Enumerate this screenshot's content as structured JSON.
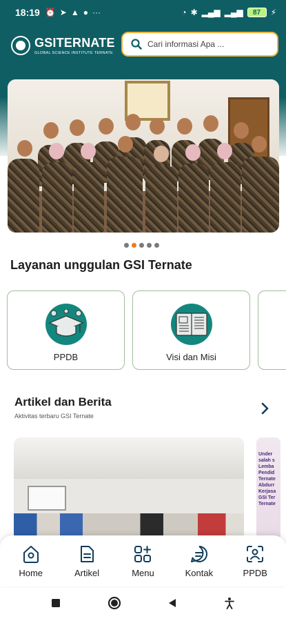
{
  "status_bar": {
    "time": "18:19",
    "battery": "87"
  },
  "header": {
    "logo_brand": "GSITERNATE",
    "logo_sub": "GLOBAL SCIENCE INSTITUTE TERNATE",
    "search_placeholder": "Cari informasi Apa ..."
  },
  "carousel": {
    "dots": 5,
    "active_index": 1
  },
  "services": {
    "title": "Layanan unggulan GSI Ternate",
    "items": [
      {
        "label": "PPDB",
        "icon": "graduation-cap-icon"
      },
      {
        "label": "Visi dan Misi",
        "icon": "open-book-icon"
      }
    ]
  },
  "articles": {
    "title": "Artikel dan Berita",
    "subtitle": "Aktivitas terbaru GSI Ternate",
    "card2_lines": [
      "Under",
      "salah s",
      "Lemba",
      "Pendid",
      "Ternate",
      "Abdurr",
      "Kerjasa",
      "GSI Ter",
      "Ternate"
    ]
  },
  "bottom_nav": {
    "items": [
      {
        "label": "Home",
        "icon": "home-icon"
      },
      {
        "label": "Artikel",
        "icon": "article-icon"
      },
      {
        "label": "Menu",
        "icon": "menu-grid-icon"
      },
      {
        "label": "Kontak",
        "icon": "contact-icon"
      },
      {
        "label": "PPDB",
        "icon": "face-scan-icon"
      }
    ]
  },
  "colors": {
    "primary": "#0f5e63",
    "accent": "#f3b239",
    "active_dot": "#ef7a1a",
    "card_border": "#9fbf98"
  }
}
